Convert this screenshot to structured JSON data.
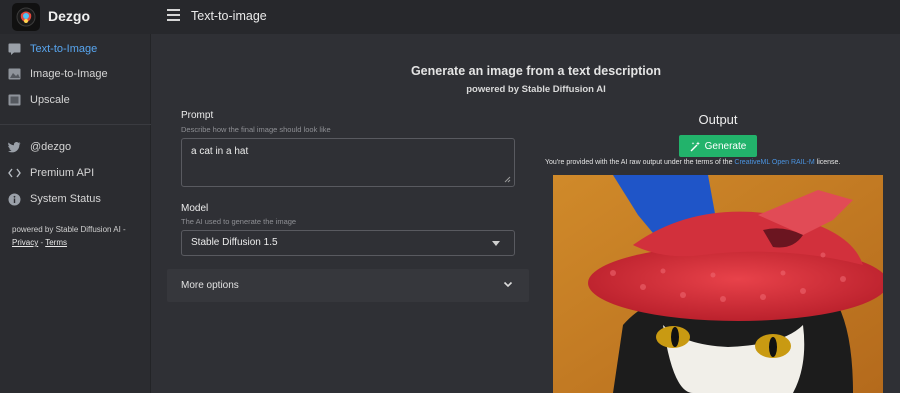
{
  "app": {
    "brand": "Dezgo",
    "page_title": "Text-to-image"
  },
  "sidebar": {
    "items": [
      {
        "label": "Text-to-Image",
        "icon": "chat-icon",
        "active": true
      },
      {
        "label": "Image-to-Image",
        "icon": "image-icon",
        "active": false
      },
      {
        "label": "Upscale",
        "icon": "upscale-icon",
        "active": false
      }
    ],
    "links": [
      {
        "label": "@dezgo",
        "icon": "twitter-icon"
      },
      {
        "label": "Premium API",
        "icon": "code-icon"
      },
      {
        "label": "System Status",
        "icon": "info-icon"
      }
    ],
    "footer": {
      "powered": "powered by Stable Diffusion AI -",
      "privacy": "Privacy",
      "sep": " - ",
      "terms": "Terms"
    }
  },
  "main": {
    "title": "Generate an image from a text description",
    "subtitle": "powered by Stable Diffusion AI",
    "prompt": {
      "label": "Prompt",
      "help": "Describe how the final image should look like",
      "value": "a cat in a hat"
    },
    "model": {
      "label": "Model",
      "help": "The AI used to generate the image",
      "selected": "Stable Diffusion 1.5"
    },
    "more_options": "More options"
  },
  "output": {
    "title": "Output",
    "generate_label": "Generate",
    "license_prefix": "You're provided with the AI raw output under the terms of the ",
    "license_link": "CreativeML Open RAIL-M",
    "license_suffix": " license."
  },
  "colors": {
    "accent": "#58a6f0",
    "generate_button": "#22b36b",
    "background": "#2f3035"
  }
}
